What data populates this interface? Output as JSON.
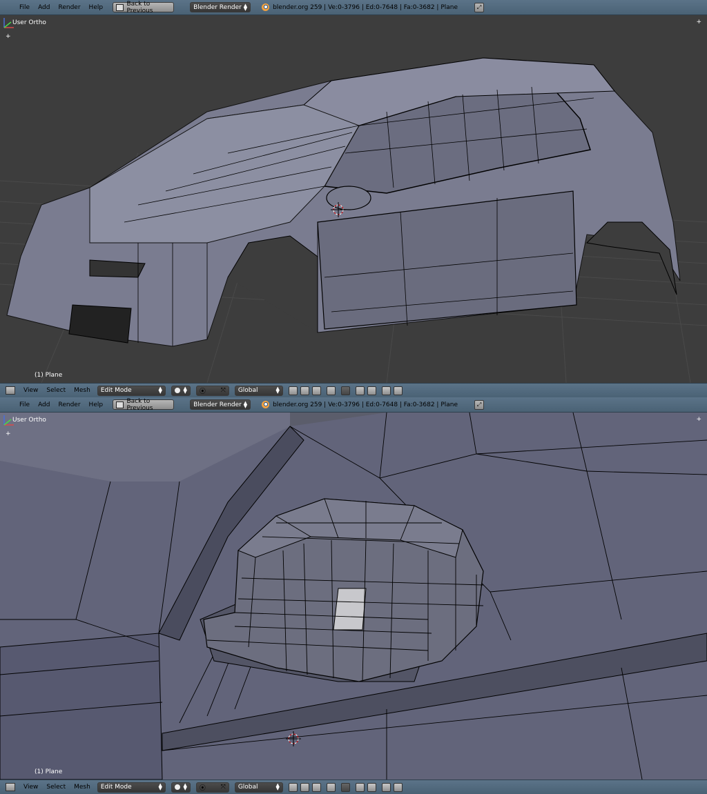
{
  "infobar": {
    "menus": [
      "File",
      "Add",
      "Render",
      "Help"
    ],
    "back_label": "Back to Previous",
    "render_engine": "Blender Render",
    "stats": "blender.org 259 | Ve:0-3796 | Ed:0-7648 | Fa:0-3682 | Plane"
  },
  "viewport_top": {
    "view_label": "User Ortho",
    "plus": "+",
    "corner": "+",
    "object_label": "(1) Plane"
  },
  "viewport_bottom": {
    "view_label": "User Ortho",
    "plus": "+",
    "corner": "+",
    "object_label": "(1) Plane"
  },
  "footer": {
    "menus": [
      "View",
      "Select",
      "Mesh"
    ],
    "mode": "Edit Mode",
    "orientation": "Global"
  },
  "colors": {
    "header": "#5b7388",
    "viewport_bg_top": "#3d3d3d",
    "viewport_bg_bottom": "#5b5d6b",
    "mesh": "#6e7083",
    "wire": "#000000"
  },
  "icons": [
    "blender-logo-icon",
    "fullscreen-icon",
    "view3d-icon",
    "shading-icon",
    "pivot-icon",
    "manipulator-icon",
    "layers-icon",
    "snap-icon",
    "render-icon"
  ]
}
